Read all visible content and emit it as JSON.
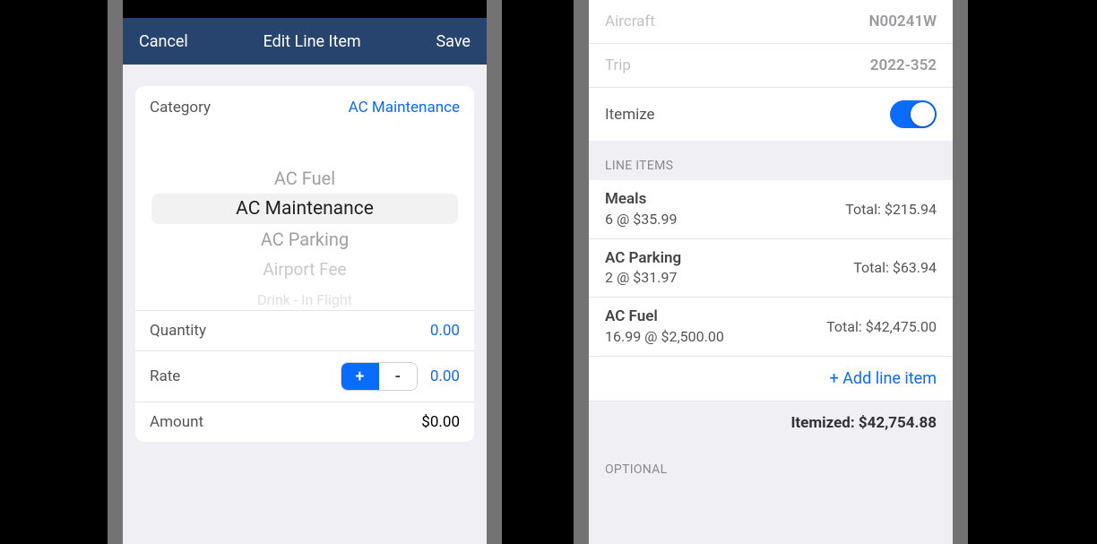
{
  "left": {
    "navbar": {
      "cancel": "Cancel",
      "title": "Edit Line Item",
      "save": "Save"
    },
    "category": {
      "label": "Category",
      "value": "AC Maintenance"
    },
    "picker": {
      "items": [
        "AC Fuel",
        "AC Maintenance",
        "AC Parking",
        "Airport Fee",
        "Drink - In Flight"
      ],
      "selected_index": 1
    },
    "fields": {
      "quantity_label": "Quantity",
      "quantity_value": "0.00",
      "rate_label": "Rate",
      "rate_value": "0.00",
      "amount_label": "Amount",
      "amount_value": "$0.00",
      "plus": "+",
      "minus": "-"
    }
  },
  "right": {
    "info": {
      "aircraft_label": "Aircraft",
      "aircraft_value": "N00241W",
      "trip_label": "Trip",
      "trip_value": "2022-352",
      "itemize_label": "Itemize",
      "itemize_on": true
    },
    "section_line_items": "LINE ITEMS",
    "line_items": [
      {
        "name": "Meals",
        "sub": "6 @ $35.99",
        "total": "Total: $215.94"
      },
      {
        "name": "AC Parking",
        "sub": "2 @ $31.97",
        "total": "Total: $63.94"
      },
      {
        "name": "AC Fuel",
        "sub": "16.99 @ $2,500.00",
        "total": "Total: $42,475.00"
      }
    ],
    "add_line_item": "+ Add line item",
    "itemized_label": "Itemized: $42,754.88",
    "section_optional": "OPTIONAL"
  }
}
